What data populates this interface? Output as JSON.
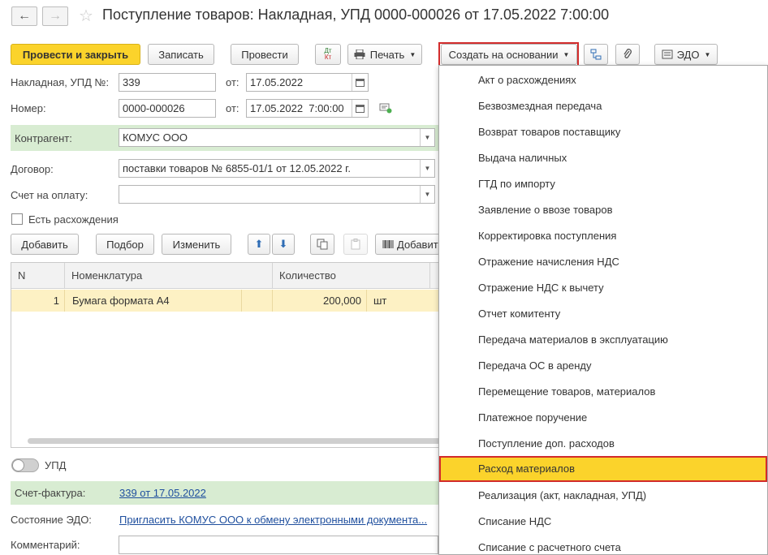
{
  "header": {
    "back_glyph": "←",
    "forward_glyph": "→",
    "star_glyph": "☆",
    "title": "Поступление товаров: Накладная, УПД 0000-000026 от 17.05.2022 7:00:00"
  },
  "toolbar": {
    "post_close": "Провести и закрыть",
    "save": "Записать",
    "post": "Провести",
    "dtkt_top": "Дт",
    "dtkt_bottom": "Кт",
    "print": "Печать",
    "create_based": "Создать на основании",
    "edo": "ЭДО"
  },
  "form": {
    "invoice_label": "Накладная, УПД №:",
    "invoice_value": "339",
    "invoice_from_label": "от:",
    "invoice_date": "17.05.2022",
    "number_label": "Номер:",
    "number_value": "0000-000026",
    "number_from_label": "от:",
    "number_date": "17.05.2022  7:00:00",
    "counterparty_label": "Контрагент:",
    "counterparty_value": "КОМУС ООО",
    "contract_label": "Договор:",
    "contract_value": "поставки товаров № 6855-01/1 от 12.05.2022 г.",
    "payment_label": "Счет на оплату:",
    "payment_value": "",
    "discrepancy_label": "Есть расхождения"
  },
  "table_toolbar": {
    "add": "Добавить",
    "pick": "Подбор",
    "change": "Изменить",
    "add_barcode": "Добавит"
  },
  "table": {
    "columns": [
      "N",
      "Номенклатура",
      "Количество"
    ],
    "rows": [
      {
        "n": "1",
        "item": "Бумага формата А4",
        "qty": "200,000",
        "unit": "шт"
      }
    ]
  },
  "bottom": {
    "upd_label": "УПД",
    "invoice_label": "Счет-фактура:",
    "invoice_link": "339 от 17.05.2022",
    "edo_label": "Состояние ЭДО:",
    "edo_link": "Пригласить КОМУС ООО к обмену электронными документа...",
    "comment_label": "Комментарий:"
  },
  "menu": {
    "items": [
      "Акт о расхождениях",
      "Безвозмездная передача",
      "Возврат товаров поставщику",
      "Выдача наличных",
      "ГТД по импорту",
      "Заявление о ввозе товаров",
      "Корректировка поступления",
      "Отражение начисления НДС",
      "Отражение НДС к вычету",
      "Отчет комитенту",
      "Передача материалов в эксплуатацию",
      "Передача ОС в аренду",
      "Перемещение товаров, материалов",
      "Платежное поручение",
      "Поступление доп. расходов",
      "Расход материалов",
      "Реализация (акт, накладная, УПД)",
      "Списание НДС",
      "Списание с расчетного счета"
    ],
    "selected": "Расход материалов"
  },
  "colors": {
    "accent": "#fbd32b",
    "highlight_frame": "#d22b2b",
    "green_row": "#d8ecd2",
    "selected_row": "#fdf1c4",
    "link": "#1f4f9e"
  }
}
